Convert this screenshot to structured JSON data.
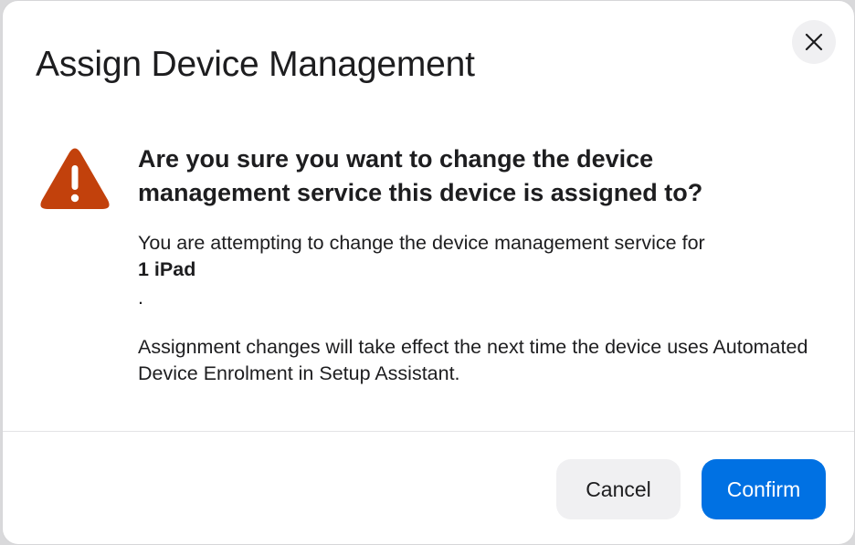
{
  "dialog": {
    "title": "Assign Device Management",
    "close_icon": "close-icon",
    "warning_icon": "warning-icon",
    "heading": "Are you sure you want to change the device management service this device is assigned to?",
    "message_prefix": "You are attempting to change the device management service for",
    "device_count": "1 iPad",
    "message_suffix": ".",
    "note": "Assignment changes will take effect the next time the device uses Automated Device Enrolment in Setup Assistant."
  },
  "buttons": {
    "cancel_label": "Cancel",
    "confirm_label": "Confirm"
  },
  "colors": {
    "accent": "#0071e3",
    "warning": "#c2410c"
  }
}
